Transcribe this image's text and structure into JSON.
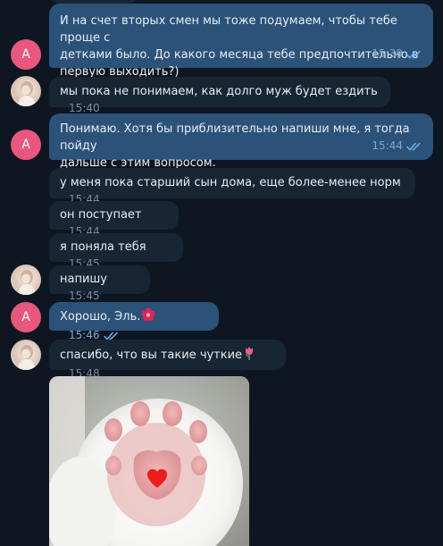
{
  "colors": {
    "background": "#0e1621",
    "outgoing_bubble": "#2b5278",
    "incoming_bubble": "#182533",
    "avatar_accent": "#e8577d",
    "read_check": "#6cb0ed"
  },
  "avatars": {
    "outgoing_initial": "A"
  },
  "messages": [
    {
      "direction": "out",
      "text": "И на счет вторых смен мы тоже подумаем, чтобы тебе проще с\nдетками было. До какого месяца тебе предпочтительно в\nпервую выходить?)",
      "time": "15:39",
      "read": true
    },
    {
      "direction": "in",
      "text": "мы пока не понимаем, как долго муж будет ездить",
      "time": "15:40"
    },
    {
      "direction": "out",
      "text": "Понимаю. Хотя бы приблизительно напиши мне, я тогда пойду\nдальше с этим вопросом.",
      "time": "15:44",
      "read": true
    },
    {
      "direction": "in",
      "text": "у меня пока старший сын дома, еще более-менее норм",
      "time": "15:44"
    },
    {
      "direction": "in",
      "text": "он поступает",
      "time": "15:44"
    },
    {
      "direction": "in",
      "text": "я поняла тебя",
      "time": "15:45"
    },
    {
      "direction": "in",
      "text": "напишу",
      "time": "15:45"
    },
    {
      "direction": "out",
      "text": "Хорошо, Эль.",
      "emoji": "hibiscus-icon",
      "time": "15:46",
      "read": true
    },
    {
      "direction": "in",
      "text": "спасибо, что вы такие чуткие",
      "emoji": "tulip-icon",
      "time": "15:48"
    }
  ],
  "photo_message": {
    "icon": "cat-paw-heart-image"
  }
}
